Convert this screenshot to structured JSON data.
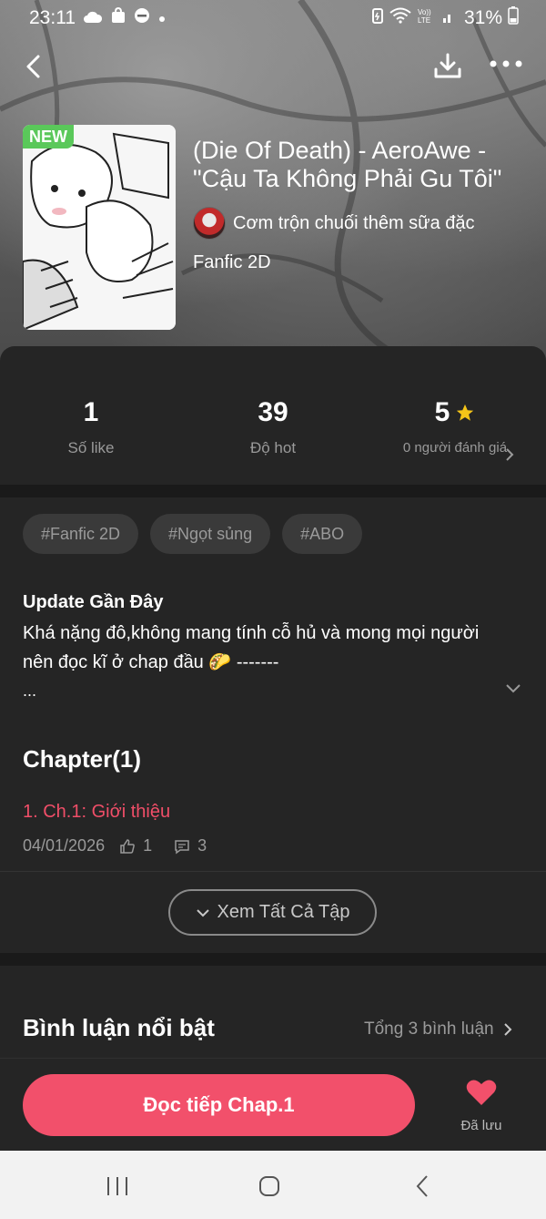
{
  "status_bar": {
    "time": "23:11",
    "battery": "31%",
    "icons": [
      "cloud-icon",
      "bag-icon",
      "dnd-icon",
      "dot-icon",
      "battery-saver-icon",
      "wifi-icon",
      "volte-icon",
      "signal-icon",
      "battery-icon"
    ]
  },
  "nav": {
    "back_icon": "back-arrow-icon",
    "download_icon": "download-icon",
    "more_icon": "more-icon"
  },
  "story": {
    "badge": "NEW",
    "title": "(Die Of Death) - AeroAwe - \"Cậu Ta Không Phải Gu Tôi\"",
    "author": "Cơm trộn chuối thêm sữa đặc",
    "genre": "Fanfic 2D"
  },
  "stats": {
    "likes": {
      "value": "1",
      "label": "Số like"
    },
    "hot": {
      "value": "39",
      "label": "Độ hot"
    },
    "rating": {
      "value": "5",
      "label": "0 người đánh giá",
      "star_color": "#f5c518"
    }
  },
  "tags": [
    "#Fanfic 2D",
    "#Ngọt sủng",
    "#ABO"
  ],
  "update": {
    "title": "Update Gần Đây",
    "text": "Khá nặng đô,không mang tính cỗ hủ và mong mọi người nên đọc kĩ ở chap đầu 🌮 -------",
    "ellipsis": "..."
  },
  "chapters": {
    "heading": "Chapter(1)",
    "items": [
      {
        "title": "1. Ch.1: Giới thiệu",
        "date": "04/01/2026",
        "likes": "1",
        "comments": "3"
      }
    ],
    "view_all_label": "Xem Tất Cả Tập"
  },
  "comments": {
    "title": "Bình luận nổi bật",
    "total": "Tổng 3 bình luận"
  },
  "bottom": {
    "read_label": "Đọc tiếp Chap.1",
    "saved_label": "Đã lưu",
    "accent": "#f2506b"
  }
}
